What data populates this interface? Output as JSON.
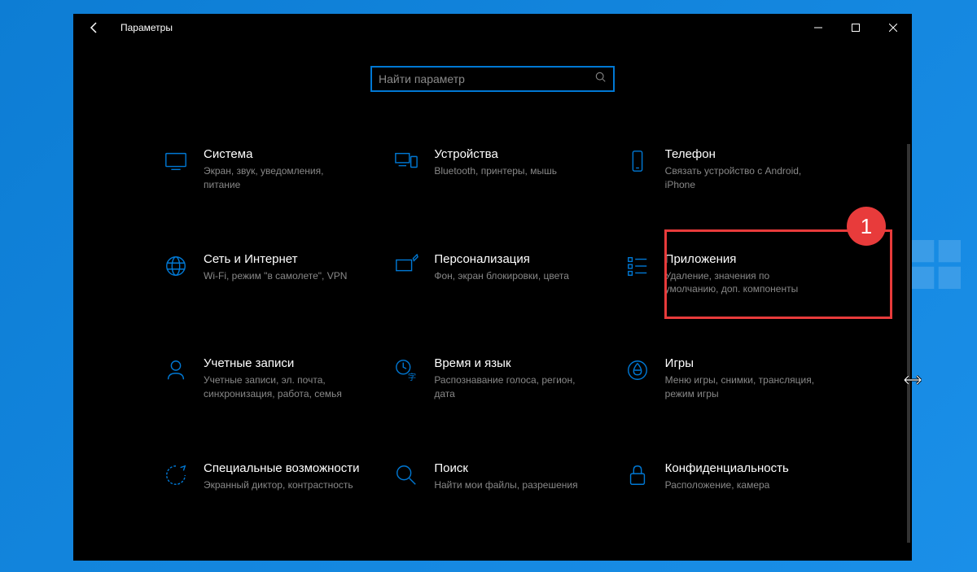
{
  "window": {
    "title": "Параметры"
  },
  "search": {
    "placeholder": "Найти параметр"
  },
  "badge": "1",
  "tiles": [
    {
      "title": "Система",
      "desc": "Экран, звук, уведомления, питание"
    },
    {
      "title": "Устройства",
      "desc": "Bluetooth, принтеры, мышь"
    },
    {
      "title": "Телефон",
      "desc": "Связать устройство с Android, iPhone"
    },
    {
      "title": "Сеть и Интернет",
      "desc": "Wi-Fi, режим \"в самолете\", VPN"
    },
    {
      "title": "Персонализация",
      "desc": "Фон, экран блокировки, цвета"
    },
    {
      "title": "Приложения",
      "desc": "Удаление, значения по умолчанию, доп. компоненты"
    },
    {
      "title": "Учетные записи",
      "desc": "Учетные записи, эл. почта, синхронизация, работа, семья"
    },
    {
      "title": "Время и язык",
      "desc": "Распознавание голоса, регион, дата"
    },
    {
      "title": "Игры",
      "desc": "Меню игры, снимки, трансляция, режим игры"
    },
    {
      "title": "Специальные возможности",
      "desc": "Экранный диктор, контрастность"
    },
    {
      "title": "Поиск",
      "desc": "Найти мои файлы, разрешения"
    },
    {
      "title": "Конфиденциальность",
      "desc": "Расположение, камера"
    }
  ]
}
